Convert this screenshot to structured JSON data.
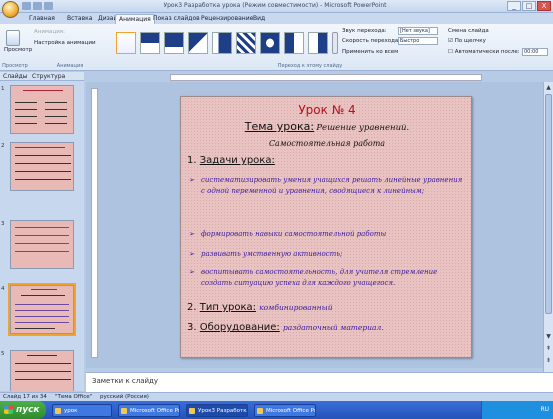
{
  "window": {
    "title": "Урок3 Разработка урока (Режим совместимости) - Microsoft PowerPoint",
    "controls": [
      "_",
      "□",
      "X"
    ]
  },
  "ribbon": {
    "tabs": [
      "Главная",
      "Вставка",
      "Дизайн",
      "Анимация",
      "Показ слайдов",
      "Рецензирование",
      "Вид"
    ],
    "active_tab": "Анимация",
    "groups": {
      "preview": {
        "button": "Просмотр",
        "label": "Просмотр"
      },
      "animation": {
        "label": "Анимация",
        "animate": "Анимация:",
        "custom": "Настройка анимации"
      },
      "transition": {
        "label": "Переход к этому слайду",
        "sound_label": "Звук перехода:",
        "sound_value": "[Нет звука]",
        "speed_label": "Скорость перехода:",
        "speed_value": "Быстро",
        "apply_all": "Применить ко всем",
        "advance_title": "Смена слайда",
        "on_click": "По щелчку",
        "auto_after": "Автоматически после:",
        "auto_value": "00:00"
      }
    }
  },
  "left_pane": {
    "tabs": [
      "Слайды",
      "Структура"
    ],
    "slide_numbers": [
      "1",
      "2",
      "3",
      "4",
      "5"
    ],
    "thumb_text": "Урок № 4"
  },
  "slide": {
    "title": "Урок № 4",
    "theme_label": "Тема урока:",
    "theme_value": "Решение уравнений.",
    "subtitle": "Самостоятельная работа",
    "section1": {
      "num": "1.",
      "label": "Задачи урока:"
    },
    "bullets": [
      "систематизировать умения учащихся решать линейные уравнения с одной переменной и уравнения, сводящиеся к линейным;",
      "формировать навыки самостоятельной работы",
      "развивать умственную активность;",
      "воспитывать самостоятельность, для учителя стремление создать ситуацию успеха для каждого учащегося."
    ],
    "section2": {
      "num": "2.",
      "label": "Тип урока:",
      "value": "комбинированный"
    },
    "section3": {
      "num": "3.",
      "label": "Оборудование:",
      "value": "раздаточный материал."
    }
  },
  "notes": {
    "placeholder": "Заметки к слайду"
  },
  "status_bar": {
    "slide_info": "Слайд 17 из 34",
    "theme": "\"Тема Office\"",
    "language": "русский (Россия)"
  },
  "taskbar": {
    "start_label": "пуск",
    "tasks": [
      "урок",
      "Microsoft Office Pow...",
      "Урок3 Разработка ...",
      "Microsoft Office Pow..."
    ],
    "active_task": 2,
    "clock": "RU"
  }
}
